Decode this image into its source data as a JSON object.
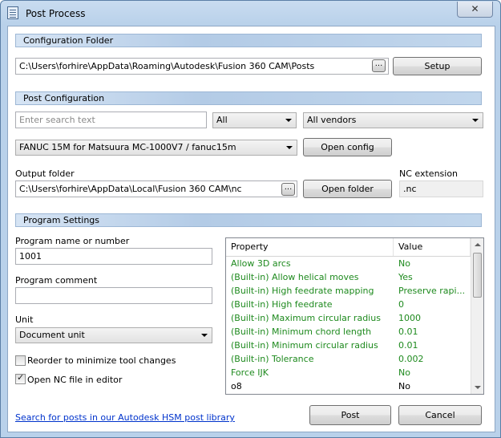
{
  "window": {
    "title": "Post Process",
    "close_glyph": "✕"
  },
  "config_folder": {
    "header": "Configuration Folder",
    "path": "C:\\Users\\forhire\\AppData\\Roaming\\Autodesk\\Fusion 360 CAM\\Posts",
    "browse_label": "...",
    "setup_label": "Setup"
  },
  "post_config": {
    "header": "Post Configuration",
    "search_placeholder": "Enter search text",
    "filter_selected": "All",
    "vendor_selected": "All vendors",
    "post_selected": "FANUC 15M for Matsuura MC-1000V7 / fanuc15m",
    "open_config_label": "Open config",
    "output_folder_label": "Output folder",
    "output_folder_path": "C:\\Users\\forhire\\AppData\\Local\\Fusion 360 CAM\\nc",
    "browse_label": "...",
    "open_folder_label": "Open folder",
    "nc_extension_label": "NC extension",
    "nc_extension_value": ".nc"
  },
  "program_settings": {
    "header": "Program Settings",
    "program_name_label": "Program name or number",
    "program_name_value": "1001",
    "program_comment_label": "Program comment",
    "program_comment_value": "",
    "unit_label": "Unit",
    "unit_selected": "Document unit",
    "reorder_label": "Reorder to minimize tool changes",
    "reorder_checked": false,
    "open_nc_label": "Open NC file in editor",
    "open_nc_checked": true,
    "check_glyph": "✓"
  },
  "properties": {
    "columns": [
      "Property",
      "Value"
    ],
    "rows": [
      {
        "property": "Allow 3D arcs",
        "value": "No",
        "color": "#1e8a1e"
      },
      {
        "property": "(Built-in) Allow helical moves",
        "value": "Yes",
        "color": "#1e8a1e"
      },
      {
        "property": "(Built-in) High feedrate mapping",
        "value": "Preserve rapi...",
        "color": "#1e8a1e"
      },
      {
        "property": "(Built-in) High feedrate",
        "value": "0",
        "color": "#1e8a1e"
      },
      {
        "property": "(Built-in) Maximum circular radius",
        "value": "1000",
        "color": "#1e8a1e"
      },
      {
        "property": "(Built-in) Minimum chord length",
        "value": "0.01",
        "color": "#1e8a1e"
      },
      {
        "property": "(Built-in) Minimum circular radius",
        "value": "0.01",
        "color": "#1e8a1e"
      },
      {
        "property": "(Built-in) Tolerance",
        "value": "0.002",
        "color": "#1e8a1e"
      },
      {
        "property": "Force IJK",
        "value": "No",
        "color": "#1e8a1e"
      },
      {
        "property": "o8",
        "value": "No",
        "color": "#000000"
      }
    ]
  },
  "footer": {
    "link_text": "Search for posts in our Autodesk HSM post library",
    "post_label": "Post",
    "cancel_label": "Cancel"
  }
}
